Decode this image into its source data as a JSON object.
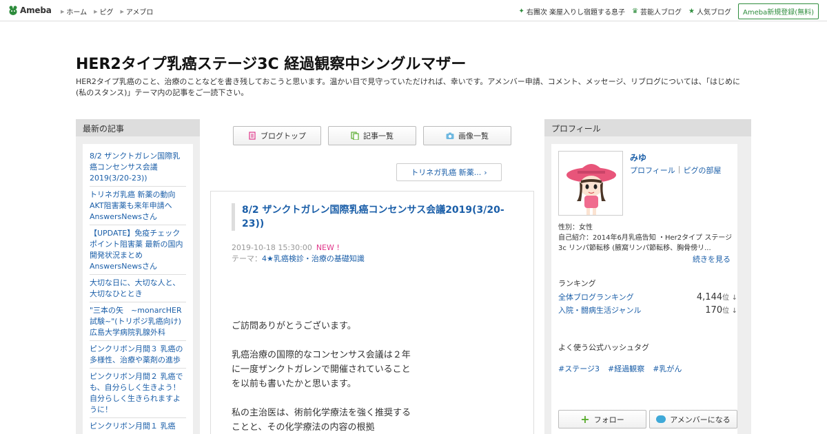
{
  "header": {
    "logo_text": "Ameba",
    "nav": [
      "ホーム",
      "ピグ",
      "アメブロ"
    ],
    "right_nav": [
      {
        "label": "右團次 楽屋入りし宿題する息子",
        "icon": "sparkle-icon"
      },
      {
        "label": "芸能人ブログ",
        "icon": "crown-icon"
      },
      {
        "label": "人気ブログ",
        "icon": "star-icon"
      }
    ],
    "register_label": "Ameba新規登録(無料)"
  },
  "blog": {
    "title": "HER2タイプ乳癌ステージ3C 経過観察中シングルマザー",
    "description": "HER2タイプ乳癌のこと、治療のことなどを書き残しておこうと思います。温かい目で見守っていただければ、幸いです。アメンバー申請、コメント、メッセージ、リブログについては、「はじめに(私のスタンス)」テーマ内の記事をご一読下さい。"
  },
  "left": {
    "heading": "最新の記事",
    "items": [
      "8/2 ザンクトガレン国際乳癌コンセンサス会議2019(3/20-23))",
      "トリネガ乳癌 新薬の動向 AKT阻害薬も来年申請へ AnswersNewsさん",
      "【UPDATE】免疫チェックポイント阻害薬 最新の国内開発状況まとめ AnswersNewsさん",
      "大切な日に、大切な人と、大切なひととき",
      "\"三本の矢　~monarcHER試験~\"(トリポジ乳癌向け) 広島大学病院乳腺外科",
      "ピンクリボン月間３ 乳癌の多様性、治療や薬剤の進歩",
      "ピンクリボン月間２ 乳癌でも、自分らしく生きよう！自分らしく生きられますように！",
      "ピンクリボン月間１ 乳癌"
    ]
  },
  "center": {
    "buttons": [
      {
        "label": "ブログトップ",
        "icon": "page-icon"
      },
      {
        "label": "記事一覧",
        "icon": "list-icon"
      },
      {
        "label": "画像一覧",
        "icon": "camera-icon"
      }
    ],
    "next_link": "トリネガ乳癌 新薬...",
    "article": {
      "title": "8/2 ザンクトガレン国際乳癌コンセンサス会議2019(3/20-23))",
      "date": "2019-10-18 15:30:00",
      "new_badge": "NEW !",
      "theme_label": "テーマ：",
      "theme": "4★乳癌検診・治療の基礎知識",
      "paragraphs": [
        "ご訪問ありがとうございます。",
        "乳癌治療の国際的なコンセンサス会議は２年に一度ザンクトガレンで開催されていることを以前も書いたかと思います。",
        "私の主治医は、術前化学療法を強く推奨することと、その化学療法の内容の根拠"
      ]
    }
  },
  "right": {
    "heading": "プロフィール",
    "name": "みゆ",
    "links": [
      "プロフィール",
      "ピグの部屋"
    ],
    "gender": "性別：女性",
    "intro": "自己紹介：2014年6月乳癌告知 ・Her2タイプ ステージ3c リンパ節転移 (腋窩リンパ節転移、胸骨傍リ...",
    "more": "続きを見る",
    "ranking_heading": "ランキング",
    "rankings": [
      {
        "label": "全体ブログランキング",
        "value": "4,144",
        "unit": "位"
      },
      {
        "label": "入院・闘病生活ジャンル",
        "value": "170",
        "unit": "位"
      }
    ],
    "hashtag_heading": "よく使う公式ハッシュタグ",
    "hashtags": [
      "#ステージ3",
      "#経過観察",
      "#乳がん"
    ],
    "follow_label": "フォロー",
    "amember_label": "アメンバーになる",
    "colors": {
      "accent": "#1a5ea8",
      "green": "#2d8c3c",
      "new": "#e0368a"
    }
  }
}
